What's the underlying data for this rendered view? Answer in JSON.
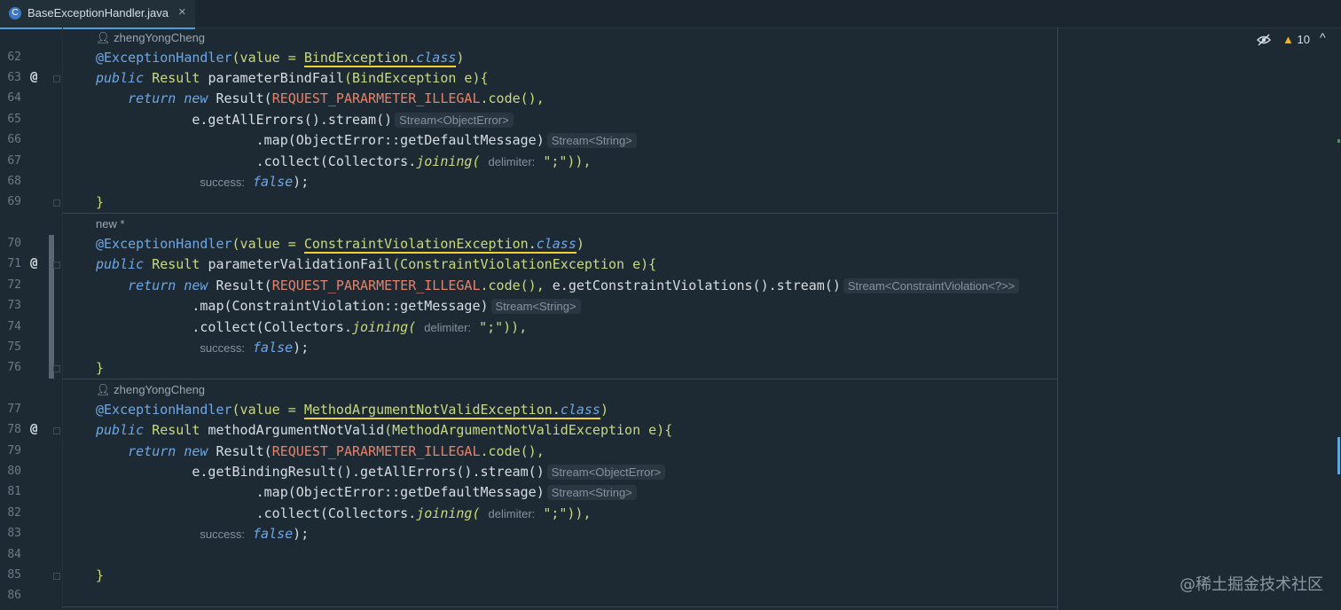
{
  "tab": {
    "filename": "BaseExceptionHandler.java",
    "file_icon": "C",
    "close": "×"
  },
  "toolbar": {
    "warnings_count": "10",
    "warn_icon": "▲",
    "chevron": "^"
  },
  "watermark": "@稀土掘金技术社区",
  "gutter": {
    "lines": [
      "62",
      "63",
      "64",
      "65",
      "66",
      "67",
      "68",
      "69",
      "70",
      "71",
      "72",
      "73",
      "74",
      "75",
      "76",
      "77",
      "78",
      "79",
      "80",
      "81",
      "82",
      "83",
      "84",
      "85",
      "86"
    ],
    "at_symbol": "@"
  },
  "authors": {
    "a1": "zhengYongCheng",
    "a2": "new *",
    "a3": "zhengYongCheng"
  },
  "code": {
    "annotation": "@ExceptionHandler",
    "value_kw": "(value = ",
    "dot": ".",
    "class_kw": "class",
    "close_paren": ")",
    "public": "public",
    "result": "Result",
    "return": "return",
    "new": "new",
    "result_call": "Result(",
    "const": "REQUEST_PARARMETER_ILLEGAL",
    "code_call": ".code(),",
    "false": "false",
    "brace_close": "}",
    "semicolon_close": ");",
    "hint_success": "success:",
    "hint_delimiter": "delimiter:",
    "b1": {
      "exc": "BindException",
      "method": "parameterBindFail",
      "params": "(BindException e){",
      "l65": "e.getAllErrors().stream()",
      "l65_hint": "Stream<ObjectError>",
      "l66": ".map(ObjectError::getDefaultMessage)",
      "l66_hint": "Stream<String>",
      "l67a": ".collect(Collectors.",
      "l67b": "joining(",
      "l67c": "\";\")),"
    },
    "b2": {
      "exc": "ConstraintViolationException",
      "method": "parameterValidationFail",
      "params": "(ConstraintViolationException e){",
      "l72": "e.getConstraintViolations().stream()",
      "l72_hint": "Stream<ConstraintViolation<?>>",
      "l73": ".map(ConstraintViolation::getMessage)",
      "l73_hint": "Stream<String>",
      "l74a": ".collect(Collectors.",
      "l74b": "joining(",
      "l74c": "\";\")),"
    },
    "b3": {
      "exc": "MethodArgumentNotValidException",
      "method": "methodArgumentNotValid",
      "params": "(MethodArgumentNotValidException e){",
      "l80": "e.getBindingResult().getAllErrors().stream()",
      "l80_hint": "Stream<ObjectError>",
      "l81": ".map(ObjectError::getDefaultMessage)",
      "l81_hint": "Stream<String>",
      "l82a": ".collect(Collectors.",
      "l82b": "joining(",
      "l82c": "\";\")),"
    }
  },
  "icons": [
    "file-java-class-icon",
    "eye-hidden-icon",
    "warning-icon",
    "chevron-up-icon",
    "user-icon"
  ]
}
